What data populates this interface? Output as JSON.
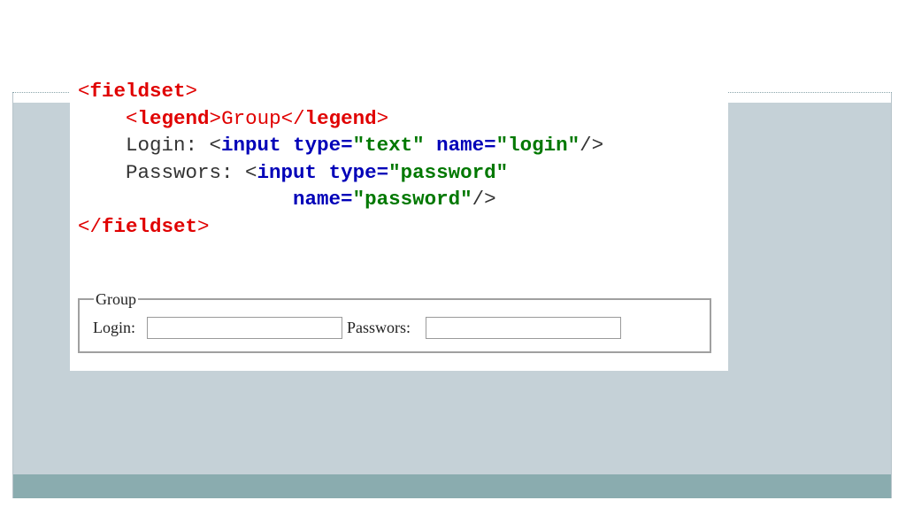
{
  "code": {
    "lines": [
      [
        {
          "t": "<",
          "c": "tag",
          "b": false
        },
        {
          "t": "fieldset",
          "c": "tag",
          "b": true
        },
        {
          "t": ">",
          "c": "tag",
          "b": false
        }
      ],
      [
        {
          "t": "    ",
          "c": "txt",
          "b": false
        },
        {
          "t": "<",
          "c": "tag",
          "b": false
        },
        {
          "t": "legend",
          "c": "tag",
          "b": true
        },
        {
          "t": ">",
          "c": "tag",
          "b": false
        },
        {
          "t": "Group",
          "c": "tag",
          "b": false
        },
        {
          "t": "</",
          "c": "tag",
          "b": false
        },
        {
          "t": "legend",
          "c": "tag",
          "b": true
        },
        {
          "t": ">",
          "c": "tag",
          "b": false
        }
      ],
      [
        {
          "t": "    Login: <",
          "c": "txt",
          "b": false
        },
        {
          "t": "input",
          "c": "kw",
          "b": true
        },
        {
          "t": " ",
          "c": "txt",
          "b": false
        },
        {
          "t": "type=",
          "c": "kw",
          "b": true
        },
        {
          "t": "\"text\"",
          "c": "str",
          "b": true
        },
        {
          "t": " ",
          "c": "txt",
          "b": false
        },
        {
          "t": "name=",
          "c": "kw",
          "b": true
        },
        {
          "t": "\"login\"",
          "c": "str",
          "b": true
        },
        {
          "t": "/>",
          "c": "txt",
          "b": false
        }
      ],
      [
        {
          "t": "    Passwors: <",
          "c": "txt",
          "b": false
        },
        {
          "t": "input",
          "c": "kw",
          "b": true
        },
        {
          "t": " ",
          "c": "txt",
          "b": false
        },
        {
          "t": "type=",
          "c": "kw",
          "b": true
        },
        {
          "t": "\"password\"",
          "c": "str",
          "b": true
        }
      ],
      [
        {
          "t": "                  ",
          "c": "txt",
          "b": false
        },
        {
          "t": "name=",
          "c": "kw",
          "b": true
        },
        {
          "t": "\"password\"",
          "c": "str",
          "b": true
        },
        {
          "t": "/>",
          "c": "txt",
          "b": false
        }
      ],
      [
        {
          "t": "</",
          "c": "tag",
          "b": false
        },
        {
          "t": "fieldset",
          "c": "tag",
          "b": true
        },
        {
          "t": ">",
          "c": "tag",
          "b": false
        }
      ]
    ]
  },
  "demo": {
    "legend": "Group",
    "login_label": "Login:",
    "login_value": "",
    "password_label": "Passwors:",
    "password_value": ""
  },
  "colors": {
    "tag": "#e00000",
    "keyword": "#0000b8",
    "string": "#007800",
    "content_band": "#c5d1d7",
    "bottom_band": "#8aacaf"
  }
}
